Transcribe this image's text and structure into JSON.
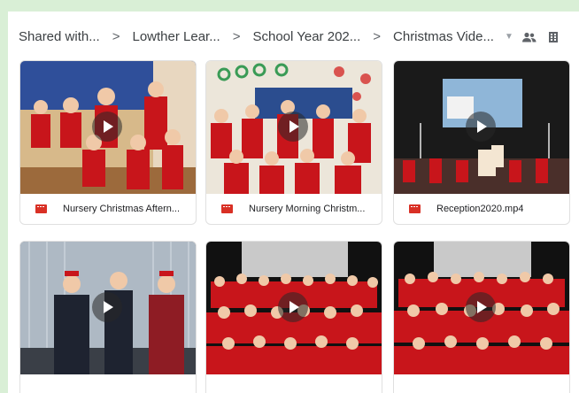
{
  "breadcrumb": {
    "items": [
      "Shared with...",
      "Lowther Lear...",
      "School Year 202...",
      "Christmas Vide..."
    ],
    "separator": ">"
  },
  "icons": {
    "caret": "dropdown-caret-icon",
    "people": "shared-people-icon",
    "view": "grid-view-icon",
    "file": "video-file-icon",
    "play": "play-icon"
  },
  "files": [
    {
      "name": "Nursery Christmas Aftern..."
    },
    {
      "name": "Nursery Morning Christm..."
    },
    {
      "name": "Reception2020.mp4"
    },
    {
      "name": ""
    },
    {
      "name": ""
    },
    {
      "name": ""
    }
  ],
  "colors": {
    "background": "#d9efd6",
    "video_icon": "#d93025",
    "uniform_red": "#c8151b"
  }
}
